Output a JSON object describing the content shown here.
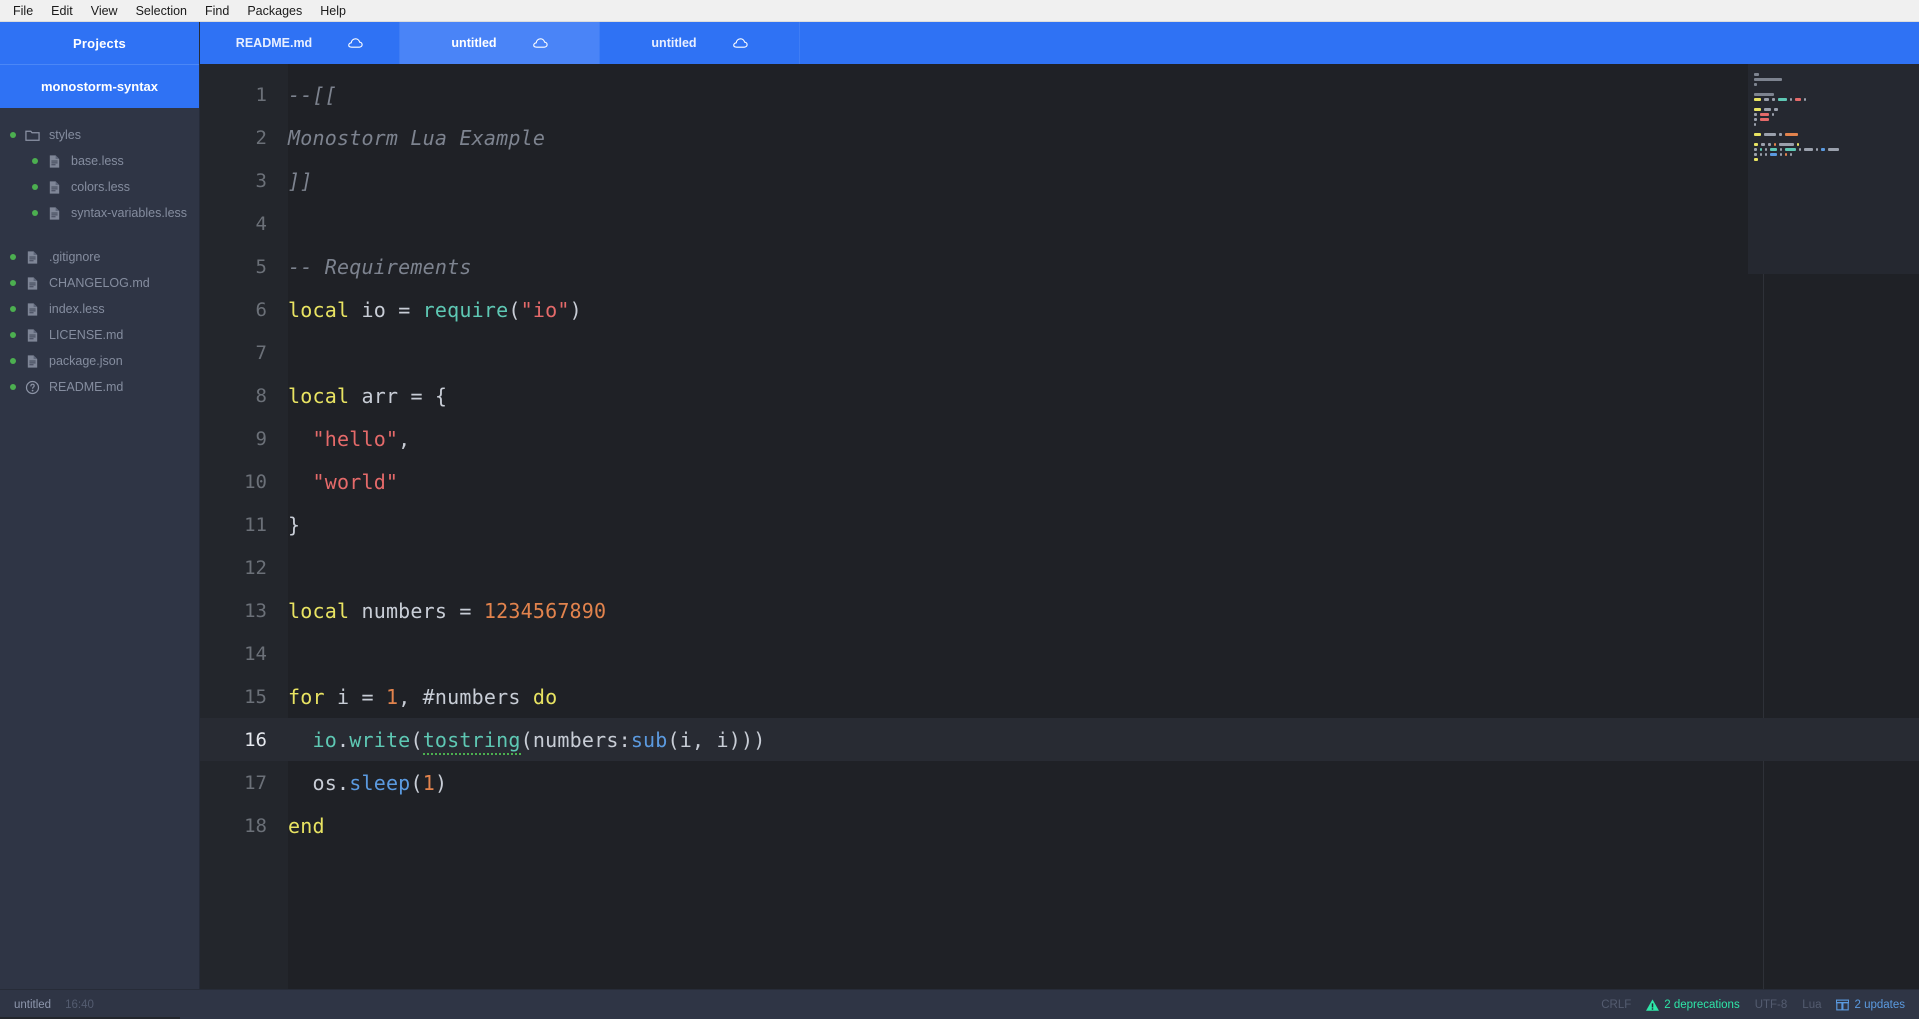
{
  "menubar": {
    "items": [
      {
        "label": "File"
      },
      {
        "label": "Edit"
      },
      {
        "label": "View"
      },
      {
        "label": "Selection"
      },
      {
        "label": "Find"
      },
      {
        "label": "Packages"
      },
      {
        "label": "Help"
      }
    ]
  },
  "sidebar": {
    "header": "Projects",
    "project_root": "monostorm-syntax",
    "tree": [
      {
        "label": "styles",
        "type": "folder",
        "indent": 0,
        "icon": "folder-icon",
        "dot": "#4caf50"
      },
      {
        "label": "base.less",
        "type": "file",
        "indent": 1,
        "icon": "file-icon",
        "dot": "#4caf50"
      },
      {
        "label": "colors.less",
        "type": "file",
        "indent": 1,
        "icon": "file-icon",
        "dot": "#4caf50"
      },
      {
        "label": "syntax-variables.less",
        "type": "file",
        "indent": 1,
        "icon": "file-icon",
        "dot": "#4caf50"
      },
      {
        "label": ".gitignore",
        "type": "file",
        "indent": 0,
        "icon": "file-icon",
        "dot": "#4caf50"
      },
      {
        "label": "CHANGELOG.md",
        "type": "file",
        "indent": 0,
        "icon": "file-icon",
        "dot": "#4caf50"
      },
      {
        "label": "index.less",
        "type": "file",
        "indent": 0,
        "icon": "file-icon",
        "dot": "#4caf50"
      },
      {
        "label": "LICENSE.md",
        "type": "file",
        "indent": 0,
        "icon": "file-icon",
        "dot": "#4caf50"
      },
      {
        "label": "package.json",
        "type": "file",
        "indent": 0,
        "icon": "file-icon",
        "dot": "#4caf50"
      },
      {
        "label": "README.md",
        "type": "file",
        "indent": 0,
        "icon": "question-circle-icon",
        "dot": "#4caf50"
      }
    ]
  },
  "tabs": [
    {
      "label": "README.md",
      "active": false,
      "icon": "cloud-icon"
    },
    {
      "label": "untitled",
      "active": true,
      "icon": "cloud-icon"
    },
    {
      "label": "untitled",
      "active": false,
      "icon": "cloud-icon"
    }
  ],
  "editor": {
    "language": "Lua",
    "active_line": 16,
    "lines": [
      {
        "n": "1",
        "tokens": [
          {
            "t": "--[[",
            "c": "com"
          }
        ]
      },
      {
        "n": "2",
        "tokens": [
          {
            "t": "Monostorm Lua Example",
            "c": "com"
          }
        ]
      },
      {
        "n": "3",
        "tokens": [
          {
            "t": "]]",
            "c": "com"
          }
        ]
      },
      {
        "n": "4",
        "tokens": []
      },
      {
        "n": "5",
        "tokens": [
          {
            "t": "-- Requirements",
            "c": "com"
          }
        ]
      },
      {
        "n": "6",
        "tokens": [
          {
            "t": "local",
            "c": "kw"
          },
          {
            "t": " io ",
            "c": "id"
          },
          {
            "t": "= ",
            "c": "punct"
          },
          {
            "t": "require",
            "c": "fn"
          },
          {
            "t": "(",
            "c": "punct"
          },
          {
            "t": "\"io\"",
            "c": "str"
          },
          {
            "t": ")",
            "c": "punct"
          }
        ]
      },
      {
        "n": "7",
        "tokens": []
      },
      {
        "n": "8",
        "tokens": [
          {
            "t": "local",
            "c": "kw"
          },
          {
            "t": " arr ",
            "c": "id"
          },
          {
            "t": "= {",
            "c": "punct"
          }
        ]
      },
      {
        "n": "9",
        "tokens": [
          {
            "t": "  ",
            "c": "id"
          },
          {
            "t": "\"hello\"",
            "c": "str"
          },
          {
            "t": ",",
            "c": "punct"
          }
        ]
      },
      {
        "n": "10",
        "tokens": [
          {
            "t": "  ",
            "c": "id"
          },
          {
            "t": "\"world\"",
            "c": "str"
          }
        ]
      },
      {
        "n": "11",
        "tokens": [
          {
            "t": "}",
            "c": "punct"
          }
        ]
      },
      {
        "n": "12",
        "tokens": []
      },
      {
        "n": "13",
        "tokens": [
          {
            "t": "local",
            "c": "kw"
          },
          {
            "t": " numbers ",
            "c": "id"
          },
          {
            "t": "= ",
            "c": "punct"
          },
          {
            "t": "1234567890",
            "c": "num"
          }
        ]
      },
      {
        "n": "14",
        "tokens": []
      },
      {
        "n": "15",
        "tokens": [
          {
            "t": "for",
            "c": "kw"
          },
          {
            "t": " i ",
            "c": "id"
          },
          {
            "t": "= ",
            "c": "punct"
          },
          {
            "t": "1",
            "c": "num"
          },
          {
            "t": ", #numbers ",
            "c": "id"
          },
          {
            "t": "do",
            "c": "kw"
          }
        ]
      },
      {
        "n": "16",
        "tokens": [
          {
            "t": "  ",
            "c": "id"
          },
          {
            "t": "io",
            "c": "fn"
          },
          {
            "t": ".",
            "c": "punct"
          },
          {
            "t": "write",
            "c": "fn"
          },
          {
            "t": "(",
            "c": "punct"
          },
          {
            "t": "tostring",
            "c": "fn squiggle"
          },
          {
            "t": "(",
            "c": "punct"
          },
          {
            "t": "numbers",
            "c": "id"
          },
          {
            "t": ":",
            "c": "punct"
          },
          {
            "t": "sub",
            "c": "fn2"
          },
          {
            "t": "(i, i)))",
            "c": "punct"
          }
        ]
      },
      {
        "n": "17",
        "tokens": [
          {
            "t": "  ",
            "c": "id"
          },
          {
            "t": "os",
            "c": "id"
          },
          {
            "t": ".",
            "c": "punct"
          },
          {
            "t": "sleep",
            "c": "fn2"
          },
          {
            "t": "(",
            "c": "punct"
          },
          {
            "t": "1",
            "c": "num"
          },
          {
            "t": ")",
            "c": "punct"
          }
        ]
      },
      {
        "n": "18",
        "tokens": [
          {
            "t": "end",
            "c": "kw"
          }
        ]
      }
    ]
  },
  "statusbar": {
    "file_name": "untitled",
    "cursor_position": "16:40",
    "line_ending": "CRLF",
    "deprecations": "2 deprecations",
    "encoding": "UTF-8",
    "grammar": "Lua",
    "updates": "2 updates"
  },
  "colors": {
    "accent_blue": "#2f72f4",
    "accent_blue_active": "#4a84f7",
    "sidebar_bg": "#2f3545",
    "editor_bg": "#1f2126",
    "gutter_bg": "#23262c",
    "keyword": "#e8e362",
    "string": "#e56a6a",
    "number": "#e2834d",
    "function": "#5ec8b4",
    "method": "#5b9ae0",
    "comment": "#7d838f",
    "status_green": "#2ee6a8",
    "dot_green": "#4caf50"
  }
}
